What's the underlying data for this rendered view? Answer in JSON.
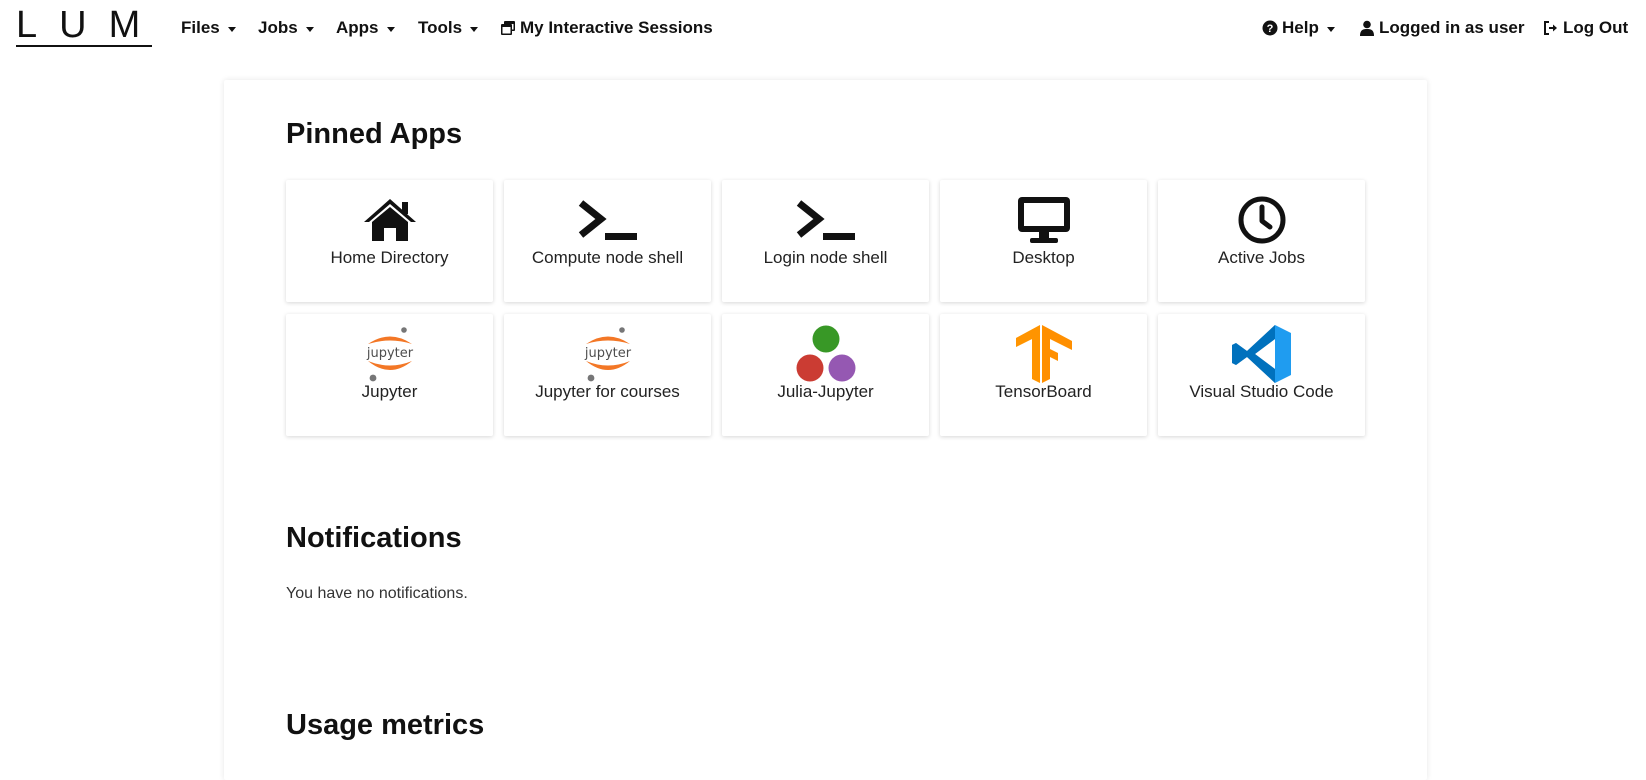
{
  "brand": {
    "name": "LUMI"
  },
  "nav": {
    "left": [
      {
        "label": "Files",
        "dropdown": true
      },
      {
        "label": "Jobs",
        "dropdown": true
      },
      {
        "label": "Apps",
        "dropdown": true
      },
      {
        "label": "Tools",
        "dropdown": true
      },
      {
        "label": "My Interactive Sessions",
        "icon": "windows-icon",
        "dropdown": false
      }
    ],
    "right": [
      {
        "label": "Help",
        "icon": "question-circle-icon",
        "dropdown": true
      },
      {
        "label": "Logged in as user",
        "icon": "user-icon",
        "dropdown": false
      },
      {
        "label": "Log Out",
        "icon": "sign-out-icon",
        "dropdown": false
      }
    ]
  },
  "pinned_apps": {
    "title": "Pinned Apps",
    "apps": [
      {
        "label": "Home Directory",
        "icon": "home-icon"
      },
      {
        "label": "Compute node shell",
        "icon": "terminal-icon"
      },
      {
        "label": "Login node shell",
        "icon": "terminal-icon"
      },
      {
        "label": "Desktop",
        "icon": "desktop-icon"
      },
      {
        "label": "Active Jobs",
        "icon": "clock-icon"
      },
      {
        "label": "Jupyter",
        "icon": "jupyter-logo-icon"
      },
      {
        "label": "Jupyter for courses",
        "icon": "jupyter-logo-icon"
      },
      {
        "label": "Julia-Jupyter",
        "icon": "julia-logo-icon"
      },
      {
        "label": "TensorBoard",
        "icon": "tensorflow-logo-icon"
      },
      {
        "label": "Visual Studio Code",
        "icon": "vscode-logo-icon"
      }
    ]
  },
  "notifications": {
    "title": "Notifications",
    "empty_message": "You have no notifications."
  },
  "usage_metrics": {
    "title": "Usage metrics"
  },
  "colors": {
    "jupyter_orange": "#F37726",
    "julia_green": "#389826",
    "julia_red": "#CB3C33",
    "julia_purple": "#9558B2",
    "tensorflow_orange": "#FF8F00",
    "vscode_blue": "#0078D4"
  }
}
